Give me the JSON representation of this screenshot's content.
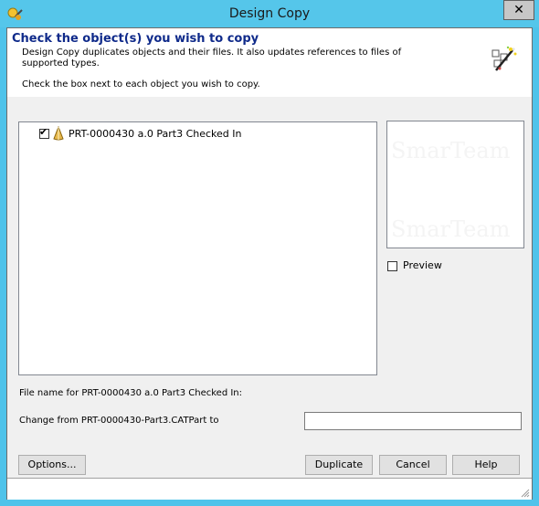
{
  "window": {
    "title": "Design Copy",
    "close_glyph": "✕"
  },
  "header": {
    "title": "Check the object(s) you wish to copy",
    "description": "Design Copy duplicates objects and their files. It also updates references to files of supported types.",
    "instruction": "Check the box next to each object you wish to copy."
  },
  "tree": {
    "items": [
      {
        "label": "PRT-0000430 a.0 Part3 Checked In",
        "checked": true,
        "icon": "cone-part-icon"
      }
    ]
  },
  "preview": {
    "label": "Preview",
    "checked": false,
    "watermark": "SmarTeam"
  },
  "file": {
    "name_label": "File name for PRT-0000430 a.0 Part3 Checked In:",
    "change_label": "Change from PRT-0000430-Part3.CATPart  to",
    "change_value": ""
  },
  "buttons": {
    "options": "Options...",
    "duplicate": "Duplicate",
    "cancel": "Cancel",
    "help": "Help"
  },
  "colors": {
    "titlebar": "#55c6ea",
    "header_title": "#0f2a8a",
    "client_bg": "#f0f0f0"
  }
}
